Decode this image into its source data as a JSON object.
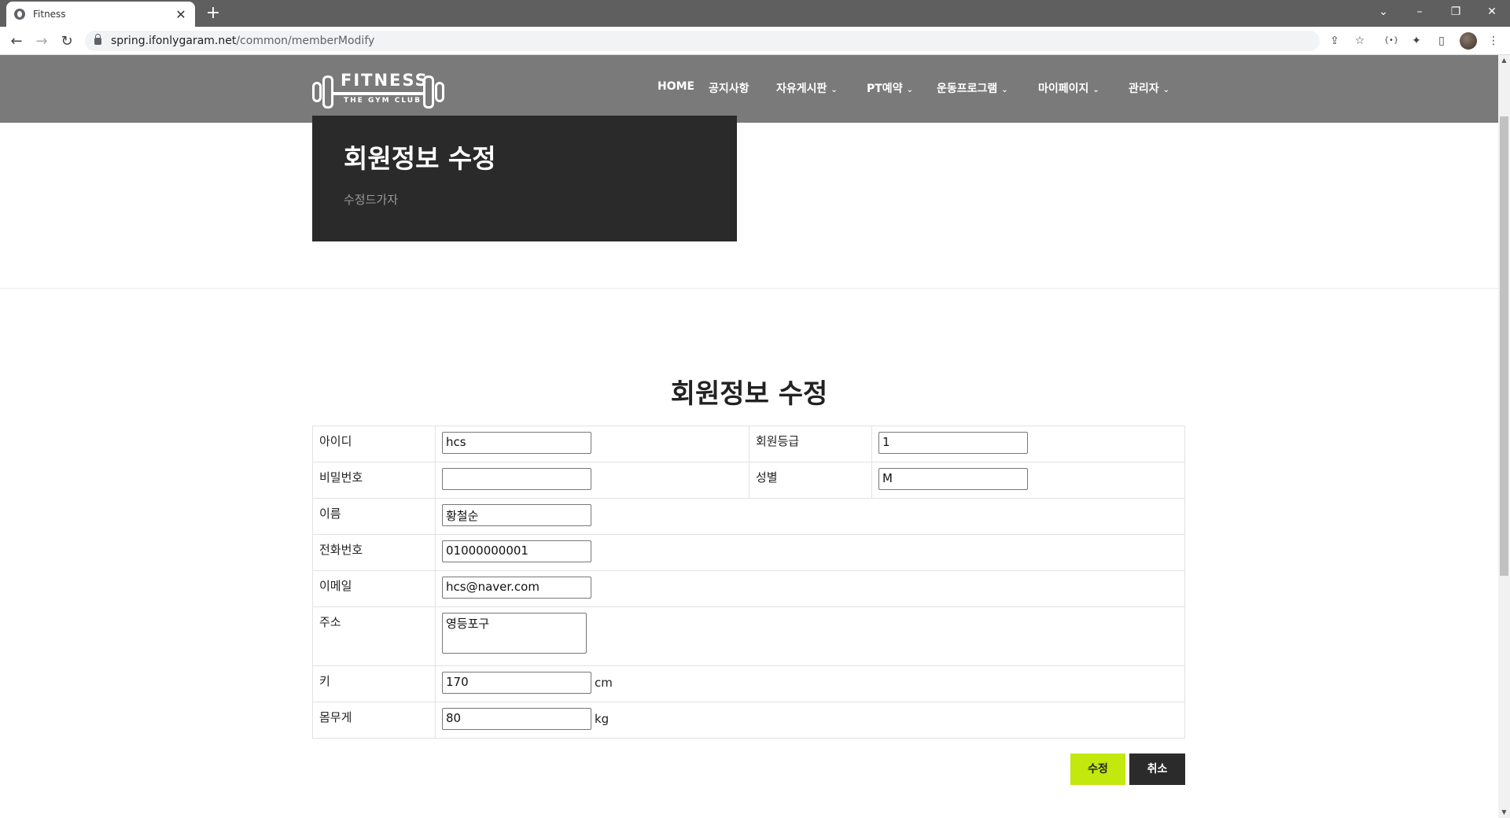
{
  "browser": {
    "tab_title": "Fitness",
    "url_host": "spring.ifonlygaram.net",
    "url_path": "/common/memberModify"
  },
  "site": {
    "logo_text": "FITNESS",
    "logo_sub": "THE GYM CLUB",
    "nav": [
      {
        "label": "HOME",
        "dropdown": false
      },
      {
        "label": "공지사항",
        "dropdown": false
      },
      {
        "label": "자유게시판",
        "dropdown": true
      },
      {
        "label": "PT예약",
        "dropdown": true
      },
      {
        "label": "운동프로그램",
        "dropdown": true
      },
      {
        "label": "마이페이지",
        "dropdown": true
      },
      {
        "label": "관리자",
        "dropdown": true
      }
    ]
  },
  "hero": {
    "title": "회원정보 수정",
    "subtitle": "수정드가자"
  },
  "form": {
    "title": "회원정보 수정",
    "fields": {
      "id": {
        "label": "아이디",
        "value": "hcs"
      },
      "grade": {
        "label": "회원등급",
        "value": "1"
      },
      "password": {
        "label": "비밀번호",
        "value": ""
      },
      "gender": {
        "label": "성별",
        "value": "M"
      },
      "name": {
        "label": "이름",
        "value": "황철순"
      },
      "phone": {
        "label": "전화번호",
        "value": "01000000001"
      },
      "email": {
        "label": "이메일",
        "value": "hcs@naver.com"
      },
      "address": {
        "label": "주소",
        "value": "영등포구"
      },
      "height": {
        "label": "키",
        "value": "170",
        "unit": "cm"
      },
      "weight": {
        "label": "몸무게",
        "value": "80",
        "unit": "kg"
      }
    },
    "submit_label": "수정",
    "cancel_label": "취소"
  },
  "colors": {
    "header_bg": "#7a7a7a",
    "hero_bg": "#2a2a2a",
    "accent": "#c3e80e",
    "dark_button": "#2b2b2b"
  }
}
